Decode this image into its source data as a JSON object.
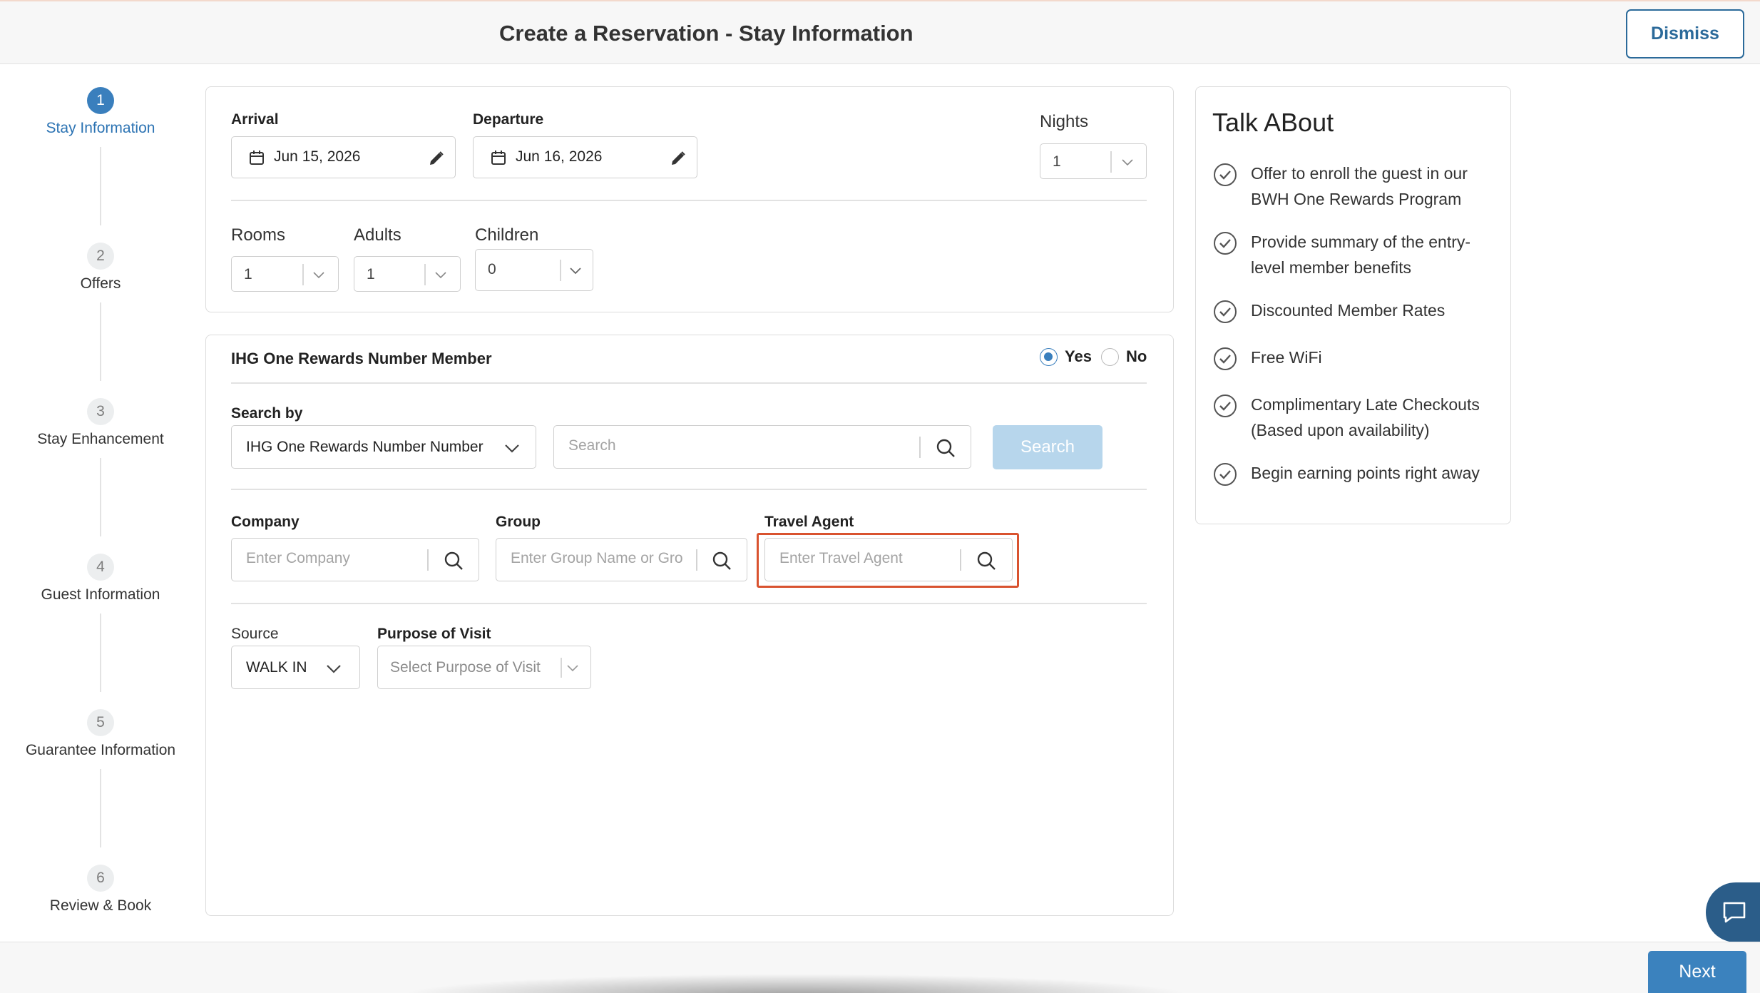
{
  "header": {
    "title": "Create a Reservation - Stay Information",
    "dismiss_label": "Dismiss"
  },
  "stepper": {
    "steps": [
      {
        "num": "1",
        "label": "Stay Information",
        "active": true
      },
      {
        "num": "2",
        "label": "Offers"
      },
      {
        "num": "3",
        "label": "Stay Enhancement"
      },
      {
        "num": "4",
        "label": "Guest Information"
      },
      {
        "num": "5",
        "label": "Guarantee Information"
      },
      {
        "num": "6",
        "label": "Review & Book"
      }
    ]
  },
  "stay": {
    "arrival_label": "Arrival",
    "arrival_value": "Jun 15, 2026",
    "departure_label": "Departure",
    "departure_value": "Jun 16, 2026",
    "nights_label": "Nights",
    "nights_value": "1",
    "rooms_label": "Rooms",
    "rooms_value": "1",
    "adults_label": "Adults",
    "adults_value": "1",
    "children_label": "Children",
    "children_value": "0"
  },
  "member": {
    "title": "IHG One Rewards Number Member",
    "yes_label": "Yes",
    "no_label": "No",
    "selected": "Yes",
    "search_by_label": "Search by",
    "search_by_value": "IHG One Rewards Number Number",
    "search_placeholder": "Search",
    "search_button": "Search",
    "company_label": "Company",
    "company_placeholder": "Enter Company",
    "group_label": "Group",
    "group_placeholder": "Enter Group Name or Group Code",
    "agent_label": "Travel Agent",
    "agent_placeholder": "Enter Travel Agent",
    "source_label": "Source",
    "source_value": "WALK IN",
    "purpose_label": "Purpose of Visit",
    "purpose_placeholder": "Select Purpose of Visit"
  },
  "talk": {
    "title": "Talk ABout",
    "items": [
      "Offer to enroll the guest in our BWH One Rewards Program",
      "Provide summary of the entry-level member benefits",
      "Discounted Member Rates",
      "Free WiFi",
      "Complimentary Late Checkouts (Based upon availability)",
      "Begin earning points right away"
    ]
  },
  "footer": {
    "next_label": "Next"
  }
}
